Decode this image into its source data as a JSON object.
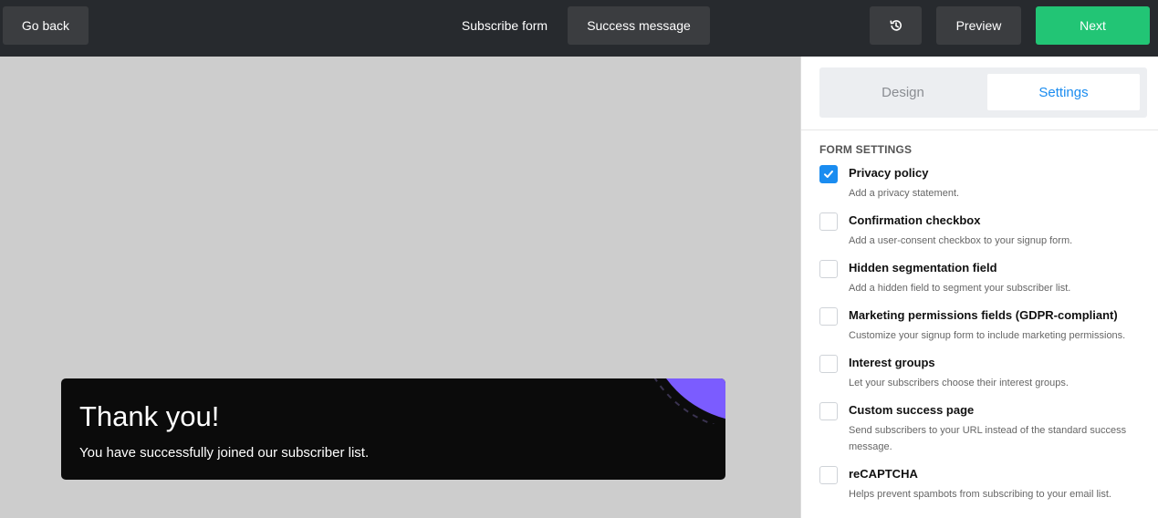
{
  "topbar": {
    "back_label": "Go back",
    "breadcrumb_subscribe": "Subscribe form",
    "breadcrumb_success": "Success message",
    "history_icon": "history-icon",
    "preview_label": "Preview",
    "next_label": "Next"
  },
  "canvas": {
    "card_title": "Thank you!",
    "card_message": "You have successfully joined our subscriber list.",
    "accent": "#7b5cff"
  },
  "panel": {
    "tabs": [
      {
        "label": "Design",
        "active": false
      },
      {
        "label": "Settings",
        "active": true
      }
    ],
    "section_title": "FORM SETTINGS",
    "options": [
      {
        "label": "Privacy policy",
        "desc": "Add a privacy statement.",
        "checked": true
      },
      {
        "label": "Confirmation checkbox",
        "desc": "Add a user-consent checkbox to your signup form.",
        "checked": false
      },
      {
        "label": "Hidden segmentation field",
        "desc": "Add a hidden field to segment your subscriber list.",
        "checked": false
      },
      {
        "label": "Marketing permissions fields (GDPR-compliant)",
        "desc": "Customize your signup form to include marketing permissions.",
        "checked": false
      },
      {
        "label": "Interest groups",
        "desc": "Let your subscribers choose their interest groups.",
        "checked": false
      },
      {
        "label": "Custom success page",
        "desc": "Send subscribers to your URL instead of the standard success message.",
        "checked": false
      },
      {
        "label": "reCAPTCHA",
        "desc": "Helps prevent spambots from subscribing to your email list.",
        "checked": false
      }
    ]
  },
  "colors": {
    "topbar_bg": "#272a2e",
    "next_green": "#22c575",
    "checkbox_blue": "#1a8cf0"
  }
}
